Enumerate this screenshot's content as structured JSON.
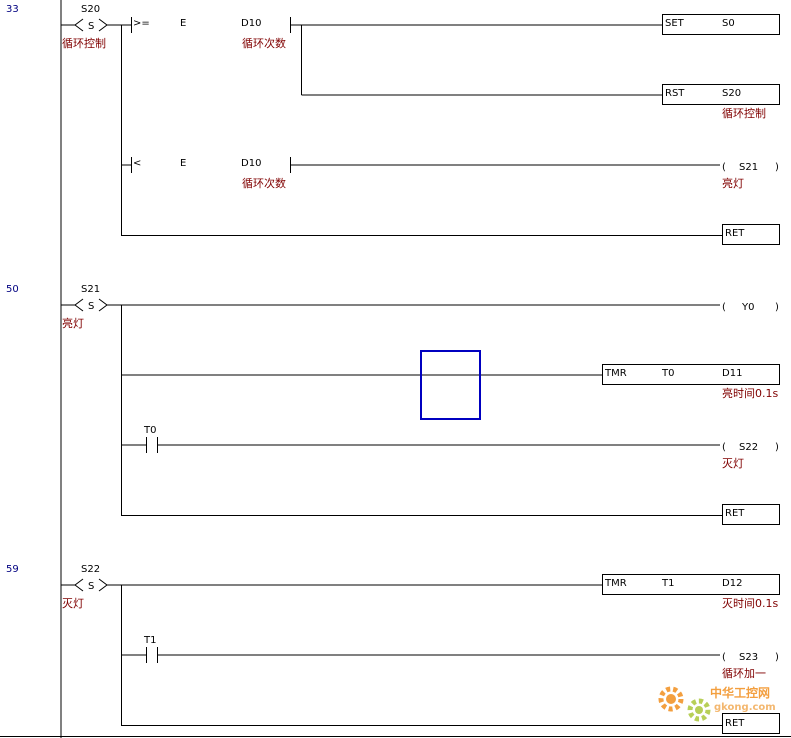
{
  "step_numbers": [
    "33",
    "50",
    "59"
  ],
  "block_33": {
    "state": "S20",
    "state_mark": "S",
    "state_comment": "循环控制",
    "cmp1_op": ">=",
    "cmp1_a": "E",
    "cmp1_b": "D10",
    "cmp1_comment": "循环次数",
    "set_op": "SET",
    "set_arg": "S0",
    "rst_op": "RST",
    "rst_arg": "S20",
    "rst_comment": "循环控制",
    "cmp2_op": "<",
    "cmp2_a": "E",
    "cmp2_b": "D10",
    "cmp2_comment": "循环次数",
    "coil_open": "(",
    "coil_arg": "S21",
    "coil_close": ")",
    "coil_comment": "亮灯",
    "ret": "RET"
  },
  "block_50": {
    "state": "S21",
    "state_mark": "S",
    "state_comment": "亮灯",
    "coil1_open": "(",
    "coil1_arg": "Y0",
    "coil1_close": ")",
    "tmr_op": "TMR",
    "tmr_timer": "T0",
    "tmr_value": "D11",
    "tmr_comment": "亮时间0.1s",
    "contact": "T0",
    "coil2_open": "(",
    "coil2_arg": "S22",
    "coil2_close": ")",
    "coil2_comment": "灭灯",
    "ret": "RET"
  },
  "block_59": {
    "state": "S22",
    "state_mark": "S",
    "state_comment": "灭灯",
    "tmr_op": "TMR",
    "tmr_timer": "T1",
    "tmr_value": "D12",
    "tmr_comment": "灭时间0.1s",
    "contact": "T1",
    "coil_open": "(",
    "coil_arg": "S23",
    "coil_close": ")",
    "coil_comment": "循环加一",
    "ret": "RET"
  },
  "watermark": {
    "name": "中华工控网",
    "url": "gkong.com"
  },
  "colors": {
    "rung": "#000000",
    "comment": "#800000",
    "step_number": "#000080",
    "cursor": "#0000c0",
    "watermark": "#f08000"
  }
}
